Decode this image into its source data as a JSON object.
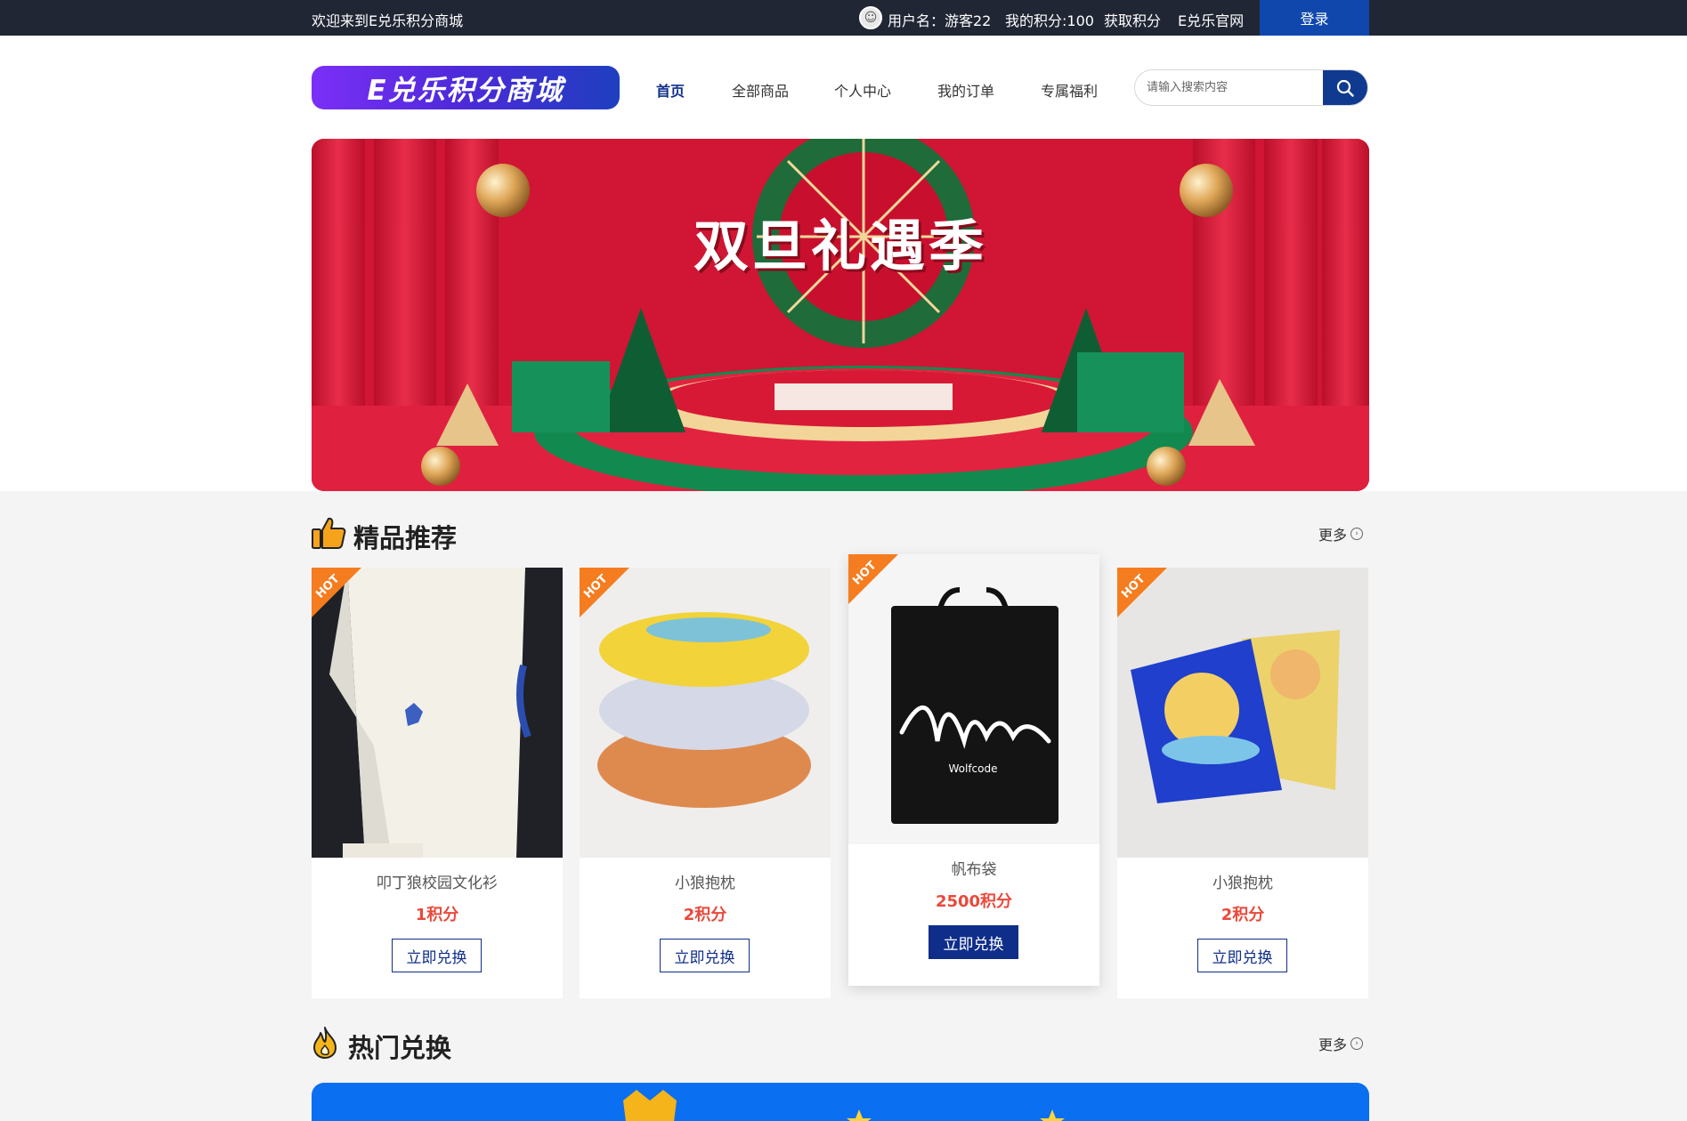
{
  "topbar": {
    "welcome": "欢迎来到E兑乐积分商城",
    "username": "用户名：游客22",
    "points": "我的积分:100",
    "earn": "获取积分",
    "site": "E兑乐官网",
    "login": "登录"
  },
  "header": {
    "logo": "E兑乐积分商城",
    "nav": [
      "首页",
      "全部商品",
      "个人中心",
      "我的订单",
      "专属福利"
    ],
    "search_placeholder": "请输入搜索内容"
  },
  "banner": {
    "title": "双旦礼遇季"
  },
  "recommend": {
    "title": "精品推荐",
    "more": "更多",
    "items": [
      {
        "name": "叩丁狼校园文化衫",
        "price": "1积分",
        "button": "立即兑换",
        "badge": "HOT"
      },
      {
        "name": "小狼抱枕",
        "price": "2积分",
        "button": "立即兑换",
        "badge": "HOT"
      },
      {
        "name": "帆布袋",
        "price": "2500积分",
        "button": "立即兑换",
        "badge": "HOT"
      },
      {
        "name": "小狼抱枕",
        "price": "2积分",
        "button": "立即兑换",
        "badge": "HOT"
      }
    ],
    "bag_print": "Wolfcode"
  },
  "hot": {
    "title": "热门兑换",
    "more": "更多"
  },
  "colors": {
    "topbar": "#212635",
    "primary": "#0f2e8a",
    "price": "#e9493b",
    "hot_badge": "#f57c1f"
  }
}
